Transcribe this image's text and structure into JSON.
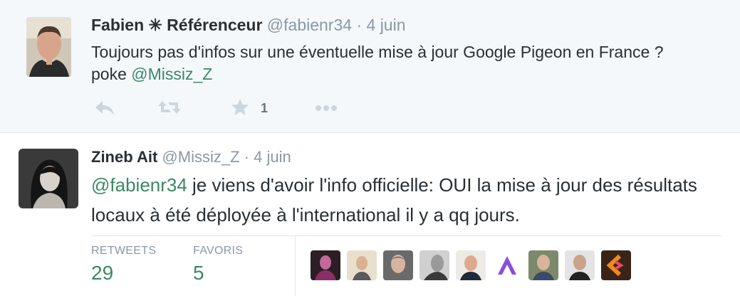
{
  "tweets": [
    {
      "name": "Fabien ✳ Référenceur",
      "handle": "@fabienr34",
      "separator": "·",
      "time": "4 juin",
      "text_line1": "Toujours pas d'infos sur une éventuelle mise à jour Google Pigeon en France ?",
      "text_poke": "poke",
      "mention": "@Missiz_Z",
      "favorite_count": "1"
    },
    {
      "name": "Zineb Ait",
      "handle": "@Missiz_Z",
      "separator": "·",
      "time": "4 juin",
      "mention": "@fabienr34",
      "text_rest": " je viens d'avoir l'info officielle: OUI la mise à jour des résultats locaux à été déployée à l'international il y a qq jours.",
      "stats": {
        "retweets_label": "RETWEETS",
        "retweets_value": "29",
        "favorites_label": "FAVORIS",
        "favorites_value": "5"
      },
      "favoriters": [
        "avatar-1",
        "avatar-2",
        "avatar-3",
        "avatar-4",
        "avatar-5",
        "avatar-6",
        "avatar-7",
        "avatar-8",
        "avatar-9"
      ]
    }
  ],
  "icons": {
    "reply": "reply-icon",
    "retweet": "retweet-icon",
    "favorite": "star-icon",
    "more": "more-icon"
  },
  "colors": {
    "mention": "#3b8866",
    "muted": "#8899a6",
    "highlight_bg": "#f5f8fa"
  }
}
